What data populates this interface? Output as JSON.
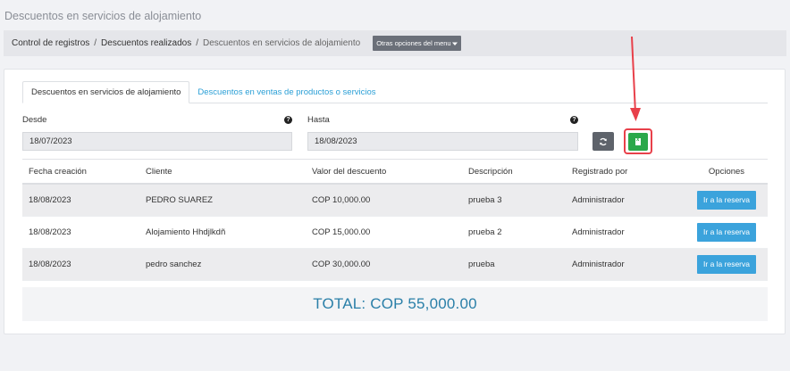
{
  "page": {
    "title": "Descuentos en servicios de alojamiento"
  },
  "breadcrumb": {
    "items": [
      "Control de registros",
      "Descuentos realizados",
      "Descuentos en servicios de alojamiento"
    ],
    "separator": "/",
    "menu_button": "Otras opciones del menu"
  },
  "tabs": [
    {
      "label": "Descuentos en servicios de alojamiento",
      "active": true
    },
    {
      "label": "Descuentos en ventas de productos o servicios",
      "active": false
    }
  ],
  "filters": {
    "from_label": "Desde",
    "from_value": "18/07/2023",
    "to_label": "Hasta",
    "to_value": "18/08/2023",
    "help_glyph": "?",
    "refresh_icon": "refresh-icon",
    "export_icon": "excel-file-icon"
  },
  "table": {
    "headers": [
      "Fecha creación",
      "Cliente",
      "Valor del descuento",
      "Descripción",
      "Registrado por",
      "Opciones"
    ],
    "rows": [
      {
        "fecha": "18/08/2023",
        "cliente": "PEDRO SUAREZ",
        "valor": "COP 10,000.00",
        "descripcion": "prueba 3",
        "registrado": "Administrador",
        "accion": "Ir a la reserva"
      },
      {
        "fecha": "18/08/2023",
        "cliente": "Alojamiento Hhdjlkdñ",
        "valor": "COP 15,000.00",
        "descripcion": "prueba 2",
        "registrado": "Administrador",
        "accion": "Ir a la reserva"
      },
      {
        "fecha": "18/08/2023",
        "cliente": "pedro sanchez",
        "valor": "COP 30,000.00",
        "descripcion": "prueba",
        "registrado": "Administrador",
        "accion": "Ir a la reserva"
      }
    ]
  },
  "total": {
    "text": "TOTAL: COP 55,000.00"
  },
  "colors": {
    "accent": "#2a9fd6",
    "excel": "#2ba84a",
    "highlight": "#e8404a",
    "action_button": "#3ba3dc"
  }
}
